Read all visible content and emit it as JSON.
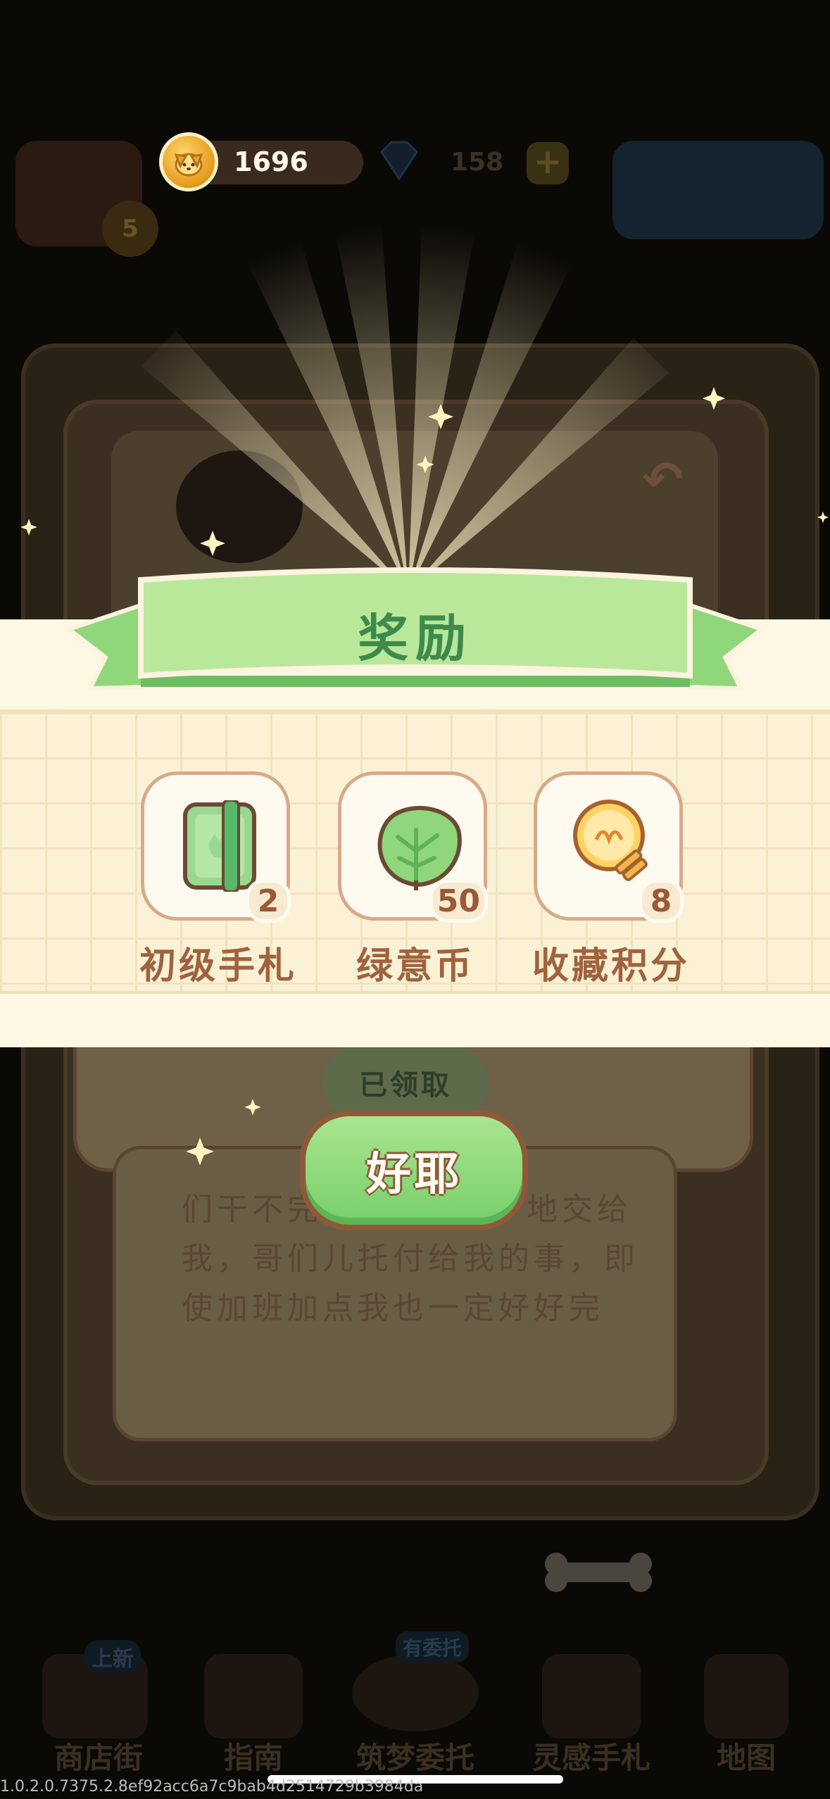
{
  "hud": {
    "coins": "1696",
    "gems": "158",
    "level": "5"
  },
  "background": {
    "claimed_label": "已领取",
    "story_lines": [
      "们干不完",
      "地交给",
      "我，哥们儿托付给我的事，即",
      "使加班加点我也一定好好完"
    ],
    "bottom_nav": [
      "商店街",
      "指南",
      "筑梦委托",
      "灵感手札",
      "地图"
    ],
    "nav_badge": "上新",
    "nav_badge_2": "有委托"
  },
  "reward": {
    "title": "奖励",
    "items": [
      {
        "icon": "green-journal-icon",
        "label": "初级手札",
        "qty": "2"
      },
      {
        "icon": "leaf-coin-icon",
        "label": "绿意币",
        "qty": "50"
      },
      {
        "icon": "lightbulb-icon",
        "label": "收藏积分",
        "qty": "8"
      }
    ],
    "confirm_label": "好耶"
  },
  "build_id": "1.0.2.0.7375.2.8ef92acc6a7c9bab4d2514729b3984da",
  "colors": {
    "ribbon_green": "#b9e89a",
    "title_green": "#3e8a4c",
    "label_brown": "#a0623f",
    "panel_cream": "#fdf7e3"
  }
}
